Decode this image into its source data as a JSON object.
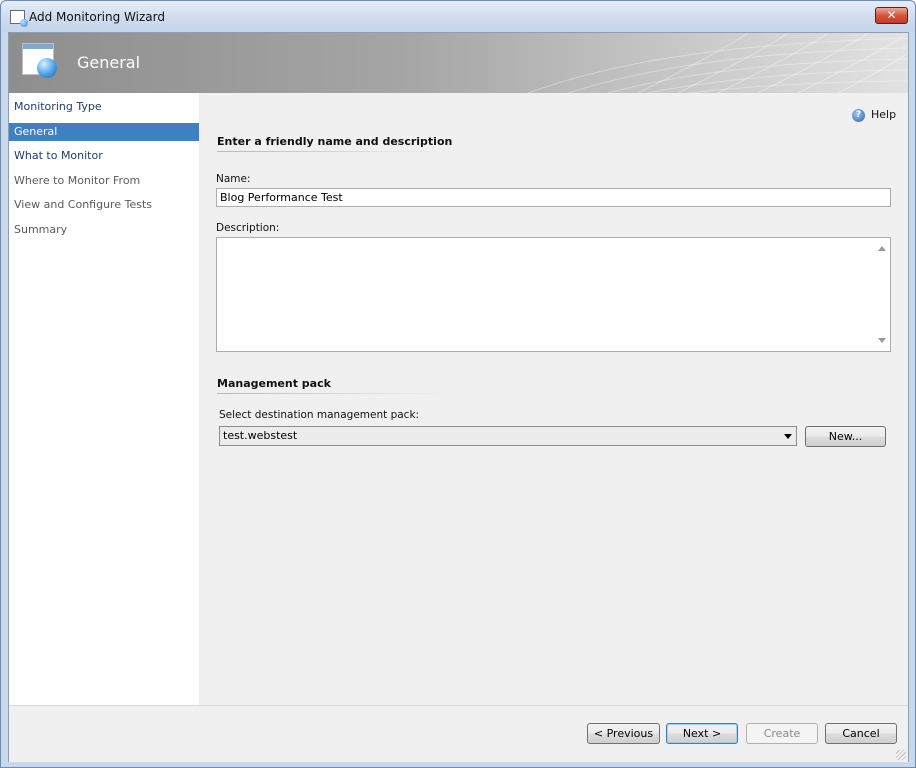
{
  "window": {
    "title": "Add Monitoring Wizard",
    "close_glyph": "✕"
  },
  "banner": {
    "title": "General"
  },
  "nav": {
    "items": [
      {
        "label": "Monitoring Type",
        "state": "done"
      },
      {
        "label": "General",
        "state": "active"
      },
      {
        "label": "What to Monitor",
        "state": "done"
      },
      {
        "label": "Where to Monitor From",
        "state": "pending"
      },
      {
        "label": "View and Configure Tests",
        "state": "pending"
      },
      {
        "label": "Summary",
        "state": "pending"
      }
    ]
  },
  "help": {
    "label": "Help",
    "icon": "help-icon"
  },
  "general": {
    "heading": "Enter a friendly name and description",
    "name_label": "Name:",
    "name_value": "Blog Performance Test",
    "description_label": "Description:",
    "description_value": ""
  },
  "management_pack": {
    "heading": "Management pack",
    "select_label": "Select destination management pack:",
    "selected": "test.webstest",
    "new_button": "New..."
  },
  "footer": {
    "previous": "< Previous",
    "next": "Next >",
    "create": "Create",
    "cancel": "Cancel"
  },
  "colors": {
    "accent": "#3f7fc2",
    "nav_link": "#1f3f6e"
  }
}
